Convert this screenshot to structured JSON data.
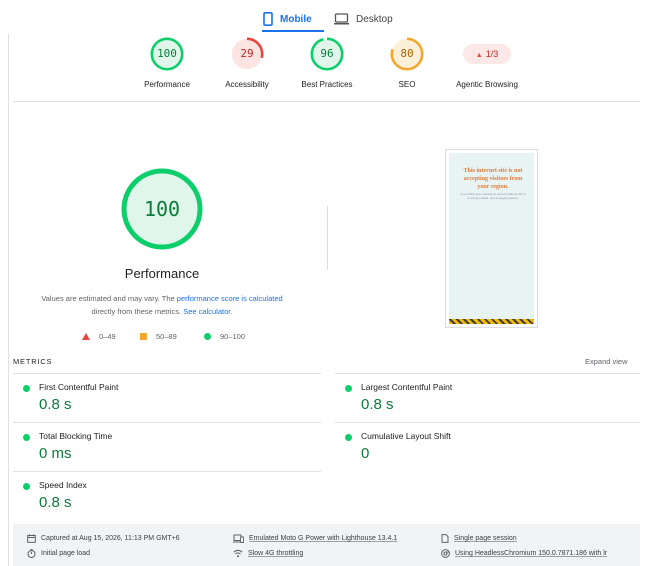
{
  "tabs": {
    "mobile_label": "Mobile",
    "desktop_label": "Desktop",
    "active": "Mobile"
  },
  "scores": [
    {
      "label": "Performance",
      "value": "100",
      "score": 100,
      "color": "#0cce6b",
      "track": "#e0f6ea",
      "text_color": "#0a7c3a"
    },
    {
      "label": "Accessibility",
      "value": "29",
      "score": 29,
      "color": "#e8453c",
      "track": "#fbe4e2",
      "text_color": "#c5221f"
    },
    {
      "label": "Best Practices",
      "value": "96",
      "score": 96,
      "color": "#0cce6b",
      "track": "#e0f6ea",
      "text_color": "#0a7c3a"
    },
    {
      "label": "SEO",
      "value": "80",
      "score": 80,
      "color": "#f4a72e",
      "track": "#fdf0d9",
      "text_color": "#b06000"
    }
  ],
  "agentic": {
    "label": "Agentic Browsing",
    "badge": "1/3",
    "badge_icon": "warning-triangle-icon"
  },
  "performance": {
    "score": "100",
    "score_value": 100,
    "title": "Performance",
    "note_prefix": "Values are estimated and may vary. The ",
    "note_link1": "performance score is calculated",
    "note_middle": " directly from these metrics. ",
    "note_link2": "See calculator",
    "note_suffix": "."
  },
  "legend": [
    {
      "shape": "triangle",
      "range": "0–49",
      "color": "#e8453c"
    },
    {
      "shape": "square",
      "range": "50–89",
      "color": "#f4a72e"
    },
    {
      "shape": "circle",
      "range": "90–100",
      "color": "#0cce6b"
    }
  ],
  "screenshot": {
    "headline": "This internet site is not accepting visitors from your region.",
    "subtext": "If you think your operations account affects this to a wrong hosted, and a staging please."
  },
  "metrics": {
    "heading": "METRICS",
    "expand_label": "Expand view",
    "items": [
      {
        "name": "First Contentful Paint",
        "value": "0.8 s"
      },
      {
        "name": "Largest Contentful Paint",
        "value": "0.8 s"
      },
      {
        "name": "Total Blocking Time",
        "value": "0 ms"
      },
      {
        "name": "Cumulative Layout Shift",
        "value": "0"
      },
      {
        "name": "Speed Index",
        "value": "0.8 s"
      }
    ]
  },
  "runtime": {
    "captured": "Captured at Aug 15, 2026, 11:13 PM GMT+6",
    "load": "Initial page load",
    "device": "Emulated Moto G Power with Lighthouse 13.4.1",
    "throttling": "Slow 4G throttling",
    "session": "Single page session",
    "browser": "Using HeadlessChromium 150.0.7871.186 with lr"
  },
  "colors": {
    "accent": "#1a73e8",
    "pass": "#0cce6b",
    "average": "#f4a72e",
    "fail": "#e8453c"
  }
}
